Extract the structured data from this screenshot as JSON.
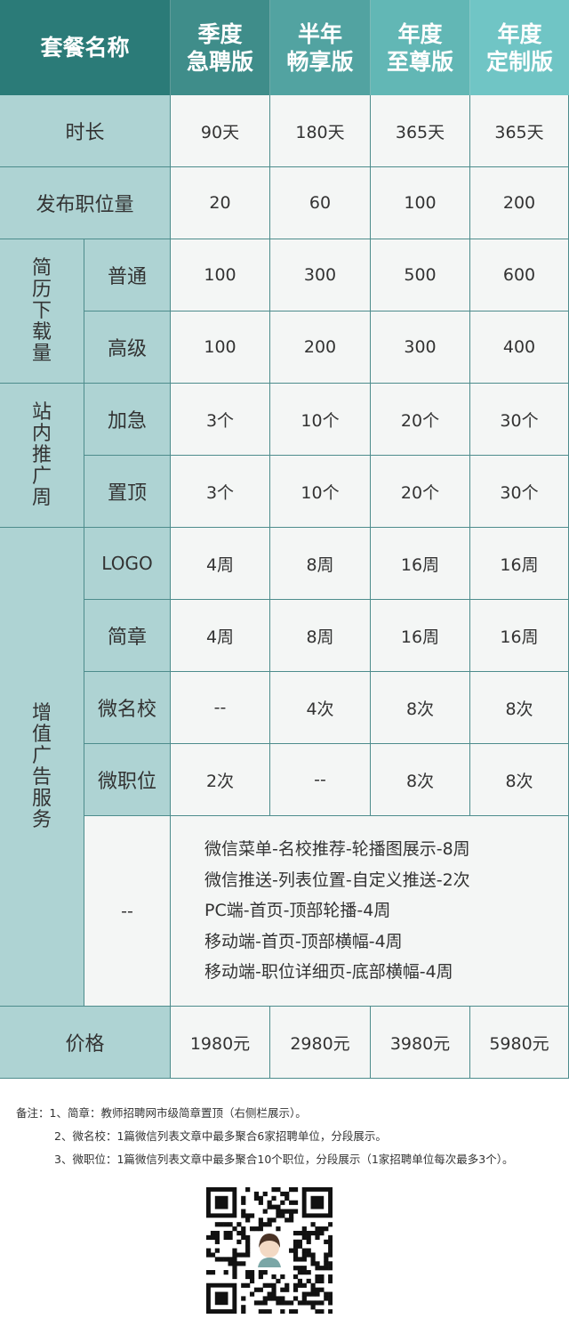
{
  "header": {
    "title": "套餐名称",
    "plans": [
      {
        "line1": "季度",
        "line2": "急聘版"
      },
      {
        "line1": "半年",
        "line2": "畅享版"
      },
      {
        "line1": "年度",
        "line2": "至尊版"
      },
      {
        "line1": "年度",
        "line2": "定制版"
      }
    ]
  },
  "rows": {
    "duration": {
      "label": "时长",
      "values": [
        "90天",
        "180天",
        "365天",
        "365天"
      ]
    },
    "postings": {
      "label": "发布职位量",
      "values": [
        "20",
        "60",
        "100",
        "200"
      ]
    },
    "resume": {
      "group_label": [
        "简",
        "历",
        "下",
        "载",
        "量"
      ],
      "normal": {
        "label": "普通",
        "values": [
          "100",
          "300",
          "500",
          "600"
        ]
      },
      "advanced": {
        "label": "高级",
        "values": [
          "100",
          "200",
          "300",
          "400"
        ]
      }
    },
    "promo": {
      "group_label": [
        "站",
        "内",
        "推",
        "广",
        "周"
      ],
      "urgent": {
        "label": "加急",
        "values": [
          "3个",
          "10个",
          "20个",
          "30个"
        ]
      },
      "pin": {
        "label": "置顶",
        "values": [
          "3个",
          "10个",
          "20个",
          "30个"
        ]
      }
    },
    "ads": {
      "group_label": [
        "增",
        "值",
        "广",
        "告",
        "服",
        "务"
      ],
      "logo": {
        "label": "LOGO",
        "values": [
          "4周",
          "8周",
          "16周",
          "16周"
        ]
      },
      "brochure": {
        "label": "简章",
        "values": [
          "4周",
          "8周",
          "16周",
          "16周"
        ]
      },
      "micro_school": {
        "label": "微名校",
        "values": [
          "--",
          "4次",
          "8次",
          "8次"
        ]
      },
      "micro_job": {
        "label": "微职位",
        "values": [
          "2次",
          "--",
          "8次",
          "8次"
        ]
      },
      "extra": {
        "label": "--",
        "lines": [
          "微信菜单-名校推荐-轮播图展示-8周",
          "微信推送-列表位置-自定义推送-2次",
          "PC端-首页-顶部轮播-4周",
          "移动端-首页-顶部横幅-4周",
          "移动端-职位详细页-底部横幅-4周"
        ]
      }
    },
    "price": {
      "label": "价格",
      "values": [
        "1980元",
        "2980元",
        "3980元",
        "5980元"
      ]
    }
  },
  "notes": [
    "备注：1、简章：教师招聘网市级简章置顶（右侧栏展示）。",
    "2、微名校：1篇微信列表文章中最多聚合6家招聘单位，分段展示。",
    "3、微职位：1篇微信列表文章中最多聚合10个职位，分段展示（1家招聘单位每次最多3个）。"
  ],
  "colors": {
    "header_start": "#2b7b78",
    "header_end": "#6fc6c6",
    "label_bg": "#aed3d3",
    "value_bg": "#f4f6f5",
    "grid": "#4d8c8c"
  },
  "qr_icon": "qr-code-icon"
}
